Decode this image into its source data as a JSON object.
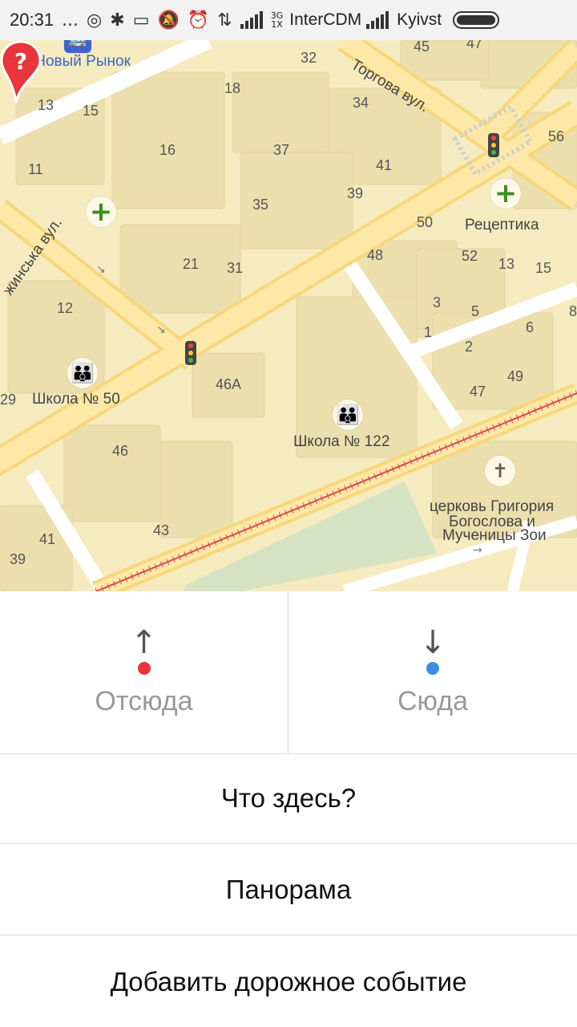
{
  "status_bar": {
    "time": "20:31",
    "dots": "...",
    "net_type_top": "3G",
    "net_type_bottom": "1X",
    "carrier1": "InterCDM",
    "carrier2": "Kyivst"
  },
  "map": {
    "streets": {
      "torgova": "Торгова вул.",
      "side": "жинська вул."
    },
    "bus_stop": "АС Новый Рынок",
    "pharmacy": "Рецептика",
    "school50": "Школа № 50",
    "school122": "Школа № 122",
    "church_line1": "церковь Григория",
    "church_line2": "Богослова и",
    "church_line3": "Мученицы Зои",
    "numbers": {
      "n45": "45",
      "n47": "47",
      "n32": "32",
      "n18": "18",
      "n34": "34",
      "n13a": "13",
      "n15a": "15",
      "n56": "56",
      "n16": "16",
      "n37": "37",
      "n41a": "41",
      "n11": "11",
      "n39a": "39",
      "n35": "35",
      "n50": "50",
      "n48": "48",
      "n52": "52",
      "n13b": "13",
      "n15b": "15",
      "n21": "21",
      "n31": "31",
      "n12": "12",
      "n3": "3",
      "n5": "5",
      "n8": "8",
      "n1": "1",
      "n6": "6",
      "n2": "2",
      "n49": "49",
      "n47b": "47",
      "n29": "29",
      "n46a": "46А",
      "n46": "46",
      "n43": "43",
      "n41b": "41",
      "n39b": "39"
    }
  },
  "actions": {
    "from_label": "Отсюда",
    "to_label": "Сюда",
    "from_arrow": "↑",
    "to_arrow": "↓",
    "from_color": "#e8343a",
    "to_color": "#3a8fe0",
    "whats_here": "Что здесь?",
    "panorama": "Панорама",
    "add_road_event": "Добавить дорожное событие"
  },
  "colors": {
    "map_bg": "#f6ebbf",
    "road": "#fde08a",
    "building": "#ecdfae",
    "park": "#d6e3c2",
    "railway": "#d94a4a"
  }
}
